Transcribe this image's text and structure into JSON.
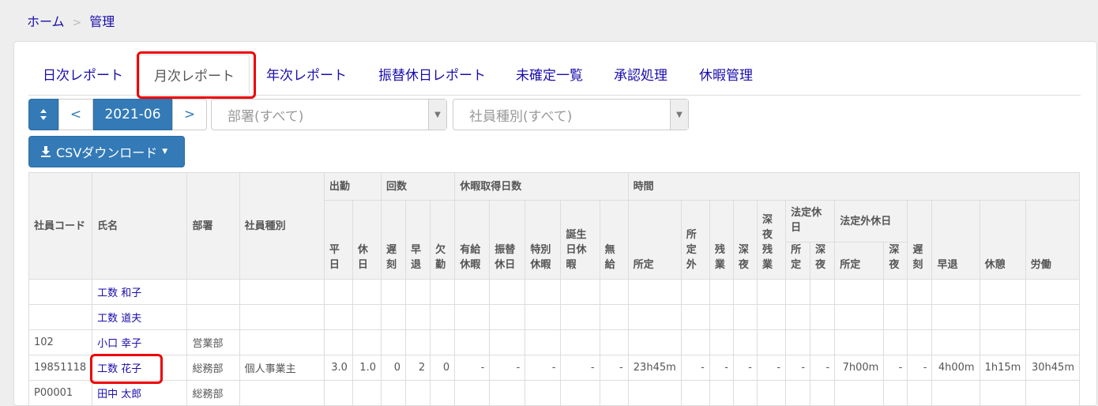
{
  "breadcrumb": {
    "home": "ホーム",
    "sep": ">",
    "current": "管理"
  },
  "tabs": [
    "日次レポート",
    "月次レポート",
    "年次レポート",
    "振替休日レポート",
    "未確定一覧",
    "承認処理",
    "休暇管理"
  ],
  "toolbar": {
    "prev": "<",
    "next": ">",
    "month": "2021-06",
    "department_placeholder": "部署(すべて)",
    "employee_type_placeholder": "社員種別(すべて)",
    "csv_button": "CSVダウンロード"
  },
  "table": {
    "headers": {
      "code": "社員コード",
      "name": "氏名",
      "dept": "部署",
      "type": "社員種別",
      "g_attendance": "出勤",
      "g_count": "回数",
      "g_leave": "休暇取得日数",
      "g_time": "時間",
      "weekday": "平日",
      "holiday": "休日",
      "late": "遅刻",
      "early": "早退",
      "absence": "欠勤",
      "paid": "有給休暇",
      "transfer": "振替休日",
      "special": "特別休暇",
      "birthday": "誕生日休暇",
      "unpaid": "無給",
      "prescribed": "所定",
      "outside": "所定外",
      "overtime": "残業",
      "night": "深夜",
      "night_ot": "深夜残業",
      "legal_holiday": "法定休日",
      "lh_prescribed": "所定",
      "lh_night": "深夜",
      "nonlegal_holiday": "法定外休日",
      "nlh_prescribed": "所定",
      "nlh_night": "深夜",
      "t_late": "遅刻",
      "t_early": "早退",
      "break": "休憩",
      "labor": "労働"
    },
    "rows": [
      {
        "code": "",
        "name": "工数 和子",
        "dept": "",
        "type": "",
        "values": []
      },
      {
        "code": "",
        "name": "工数 道夫",
        "dept": "",
        "type": "",
        "values": []
      },
      {
        "code": "102",
        "name": "小口 幸子",
        "dept": "営業部",
        "type": "",
        "values": []
      },
      {
        "code": "19851118",
        "name": "工数 花子",
        "dept": "総務部",
        "type": "個人事業主",
        "values": [
          "3.0",
          "1.0",
          "0",
          "2",
          "0",
          "-",
          "-",
          "-",
          "-",
          "-",
          "23h45m",
          "-",
          "-",
          "-",
          "-",
          "-",
          "-",
          "7h00m",
          "-",
          "-",
          "4h00m",
          "1h15m",
          "30h45m"
        ]
      },
      {
        "code": "P00001",
        "name": "田中 太郎",
        "dept": "総務部",
        "type": "",
        "values": []
      }
    ]
  }
}
